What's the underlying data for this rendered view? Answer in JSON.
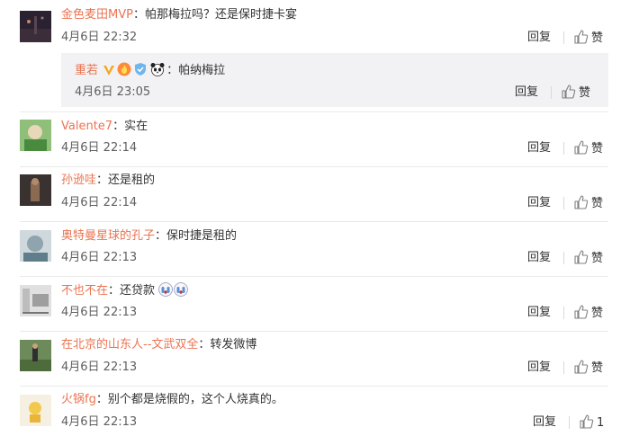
{
  "common": {
    "reply_label": "回复",
    "like_label": "赞",
    "colon": "："
  },
  "comments": [
    {
      "user": "金色麦田MVP",
      "text": "帕那梅拉吗？还是保时捷卡宴",
      "time": "4月6日 22:32"
    },
    {
      "user": "Valente7",
      "text": "实在",
      "time": "4月6日 22:14"
    },
    {
      "user": "孙逊哇",
      "text": "还是租的",
      "time": "4月6日 22:14"
    },
    {
      "user": "奥特曼星球的孔子",
      "text": "保时捷是租的",
      "time": "4月6日 22:13"
    },
    {
      "user": "不也不在",
      "text": "还贷款",
      "time": "4月6日 22:13"
    },
    {
      "user": "在北京的山东人--文武双全",
      "text": "转发微博",
      "time": "4月6日 22:13"
    },
    {
      "user": "火锅fg",
      "text": "别个都是烧假的，这个人烧真的。",
      "time": "4月6日 22:13",
      "like_count": "1"
    }
  ],
  "sub_reply": {
    "user": "重若",
    "text": "帕纳梅拉",
    "time": "4月6日 23:05"
  },
  "colors": {
    "username": "#eb7350",
    "sub_reply_bg": "#f2f2f5",
    "divider": "#eaeaea"
  },
  "icons": {
    "like": "thumbs-up-icon",
    "badges": [
      "vip-v-badge",
      "fire-badge",
      "shield-badge",
      "panda-badge"
    ],
    "emoji": "crying-face-emoji"
  }
}
